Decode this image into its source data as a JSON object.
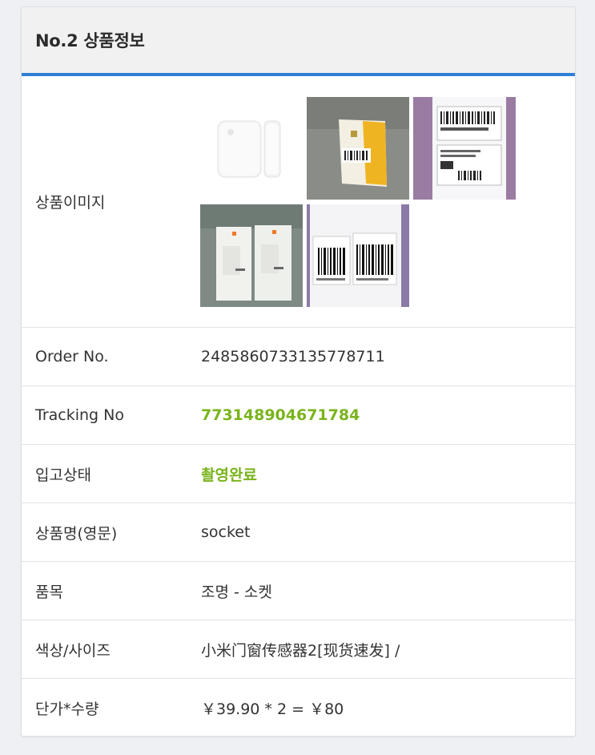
{
  "header": {
    "title": "No.2 상품정보"
  },
  "rows": {
    "images": {
      "label": "상품이미지",
      "thumbnails": [
        "door-sensor-product-photo",
        "yellow-package-photo",
        "barcode-label-photo",
        "boxed-products-photo",
        "barcode-sticker-photo"
      ]
    },
    "order_no": {
      "label": "Order No.",
      "value": "2485860733135778711"
    },
    "tracking": {
      "label": "Tracking No",
      "value": "773148904671784"
    },
    "status": {
      "label": "입고상태",
      "value": "촬영완료"
    },
    "name_en": {
      "label": "상품명(영문)",
      "value": "socket"
    },
    "category": {
      "label": "품목",
      "value": "조명 - 소켓"
    },
    "option": {
      "label": "색상/사이즈",
      "value": "小米门窗传感器2[现货速发] /"
    },
    "price": {
      "label": "단가*수량",
      "formula": "￥39.90 * 2 =",
      "total": "￥80"
    }
  },
  "colors": {
    "accent": "#2f7fd6",
    "highlight_green": "#7ab41c",
    "price_pink": "#e0297a"
  }
}
